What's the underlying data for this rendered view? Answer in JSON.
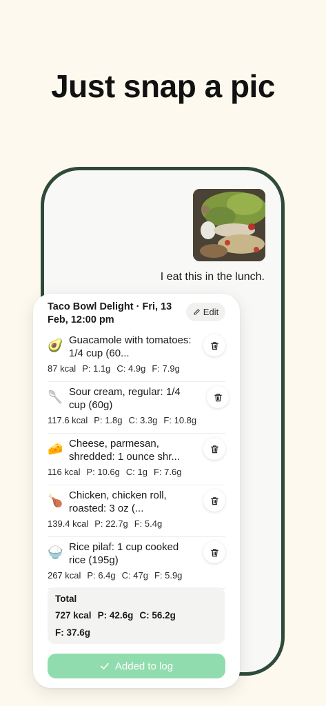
{
  "headline": "Just snap a pic",
  "chat": {
    "caption": "I eat this in the lunch."
  },
  "meal": {
    "title": "Taco Bowl Delight · Fri, 13 Feb, 12:00 pm",
    "edit_label": "Edit",
    "items": [
      {
        "emoji": "🥑",
        "name": "Guacamole with tomatoes: 1/4 cup (60...",
        "kcal": "87 kcal",
        "p": "P: 1.1g",
        "c": "C: 4.9g",
        "f": "F: 7.9g"
      },
      {
        "emoji": "🥄",
        "name": "Sour cream, regular: 1/4 cup (60g)",
        "kcal": "117.6 kcal",
        "p": "P: 1.8g",
        "c": "C: 3.3g",
        "f": "F: 10.8g"
      },
      {
        "emoji": "🧀",
        "name": "Cheese, parmesan, shredded: 1 ounce shr...",
        "kcal": "116 kcal",
        "p": "P: 10.6g",
        "c": "C: 1g",
        "f": "F: 7.6g"
      },
      {
        "emoji": "🍗",
        "name": "Chicken, chicken roll, roasted: 3 oz (...",
        "kcal": "139.4 kcal",
        "p": "P: 22.7g",
        "c": "",
        "f": "F: 5.4g"
      },
      {
        "emoji": "🍚",
        "name": "Rice pilaf: 1 cup cooked rice (195g)",
        "kcal": "267 kcal",
        "p": "P: 6.4g",
        "c": "C: 47g",
        "f": "F: 5.9g"
      }
    ],
    "total": {
      "label": "Total",
      "kcal": "727 kcal",
      "p": "P: 42.6g",
      "c": "C: 56.2g",
      "f": "F: 37.6g"
    },
    "added_label": "Added to log"
  },
  "colors": {
    "background": "#fdf9ee",
    "phone_frame": "#2f4a3a",
    "added_button": "#90dcae"
  },
  "icons": [
    "pencil-icon",
    "trash-icon",
    "check-icon"
  ]
}
